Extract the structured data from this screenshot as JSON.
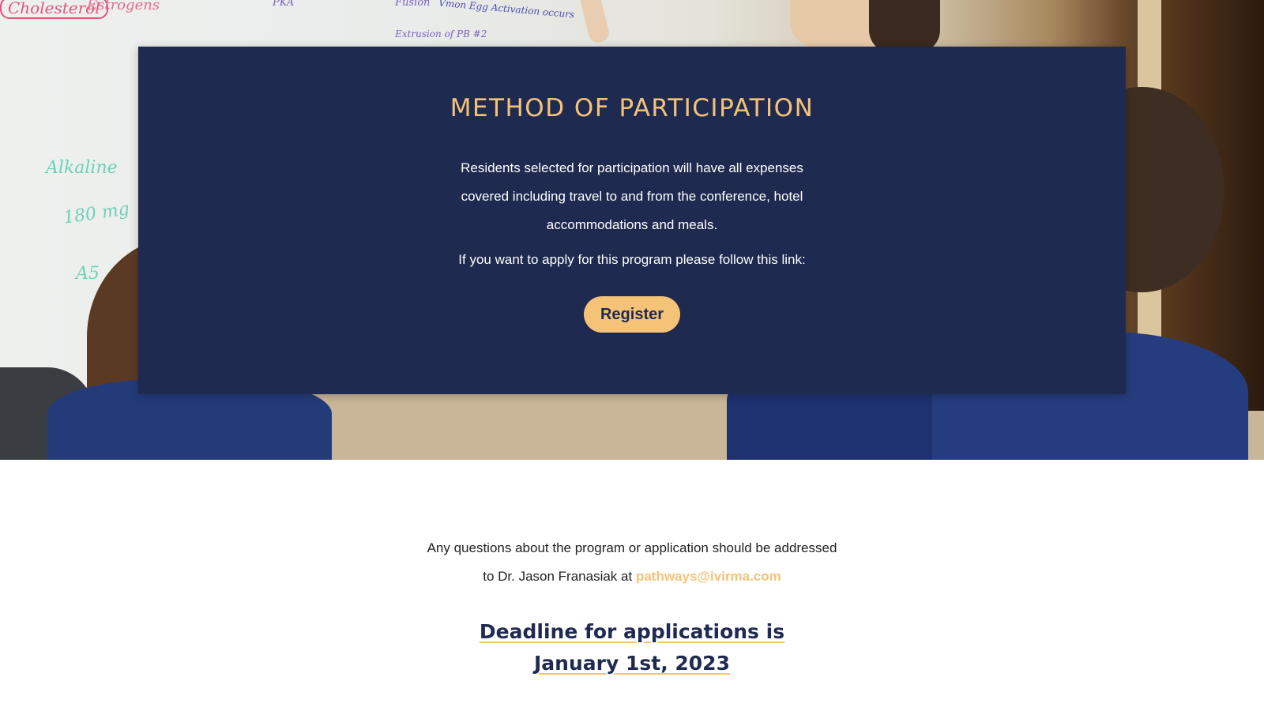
{
  "hero": {
    "whiteboard_notes": [
      "Cholesterol",
      "Estrogens",
      "Fusion",
      "Vmon Egg Activation occurs",
      "Extrusion of PB #2",
      "PKA",
      "Alkaline",
      "180 mg",
      "A5"
    ]
  },
  "participation": {
    "title": "METHOD OF PARTICIPATION",
    "body": "Residents selected for participation will have all expenses covered including travel to and from the conference, hotel accommodations and meals.",
    "link_prompt": "If you want to apply for this program please follow this link:",
    "register_label": "Register"
  },
  "contact": {
    "line1": "Any questions about the program or application should be addressed",
    "line2_prefix": "to Dr. Jason Franasiak at",
    "email": "pathways@ivirma.com"
  },
  "deadline": {
    "line1": "Deadline for applications is",
    "line2": "January 1st, 2023"
  },
  "colors": {
    "navy": "#1e2a4f",
    "accent": "#f5c377"
  }
}
